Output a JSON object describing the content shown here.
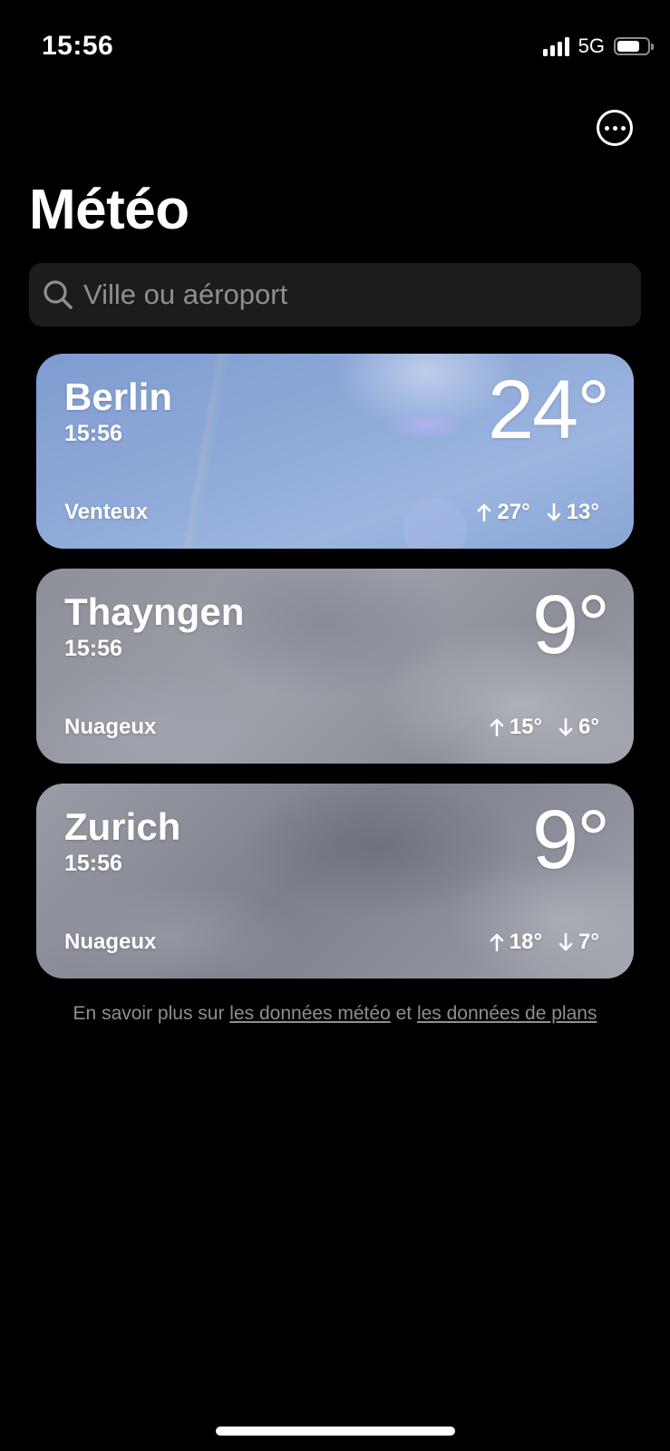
{
  "status_bar": {
    "time": "15:56",
    "network": "5G",
    "battery_level": 0.75,
    "signal_bars": 4
  },
  "header": {
    "title": "Météo",
    "more_icon": "ellipsis-circle-icon"
  },
  "search": {
    "placeholder": "Ville ou aéroport",
    "icon": "search-icon"
  },
  "cities": [
    {
      "name": "Berlin",
      "time": "15:56",
      "temperature": "24°",
      "condition": "Venteux",
      "high": "27°",
      "low": "13°"
    },
    {
      "name": "Thayngen",
      "time": "15:56",
      "temperature": "9°",
      "condition": "Nuageux",
      "high": "15°",
      "low": "6°"
    },
    {
      "name": "Zurich",
      "time": "15:56",
      "temperature": "9°",
      "condition": "Nuageux",
      "high": "18°",
      "low": "7°"
    }
  ],
  "footer": {
    "prefix": "En savoir plus sur ",
    "link1": "les données météo",
    "connector": " et ",
    "link2": "les données de plans"
  }
}
